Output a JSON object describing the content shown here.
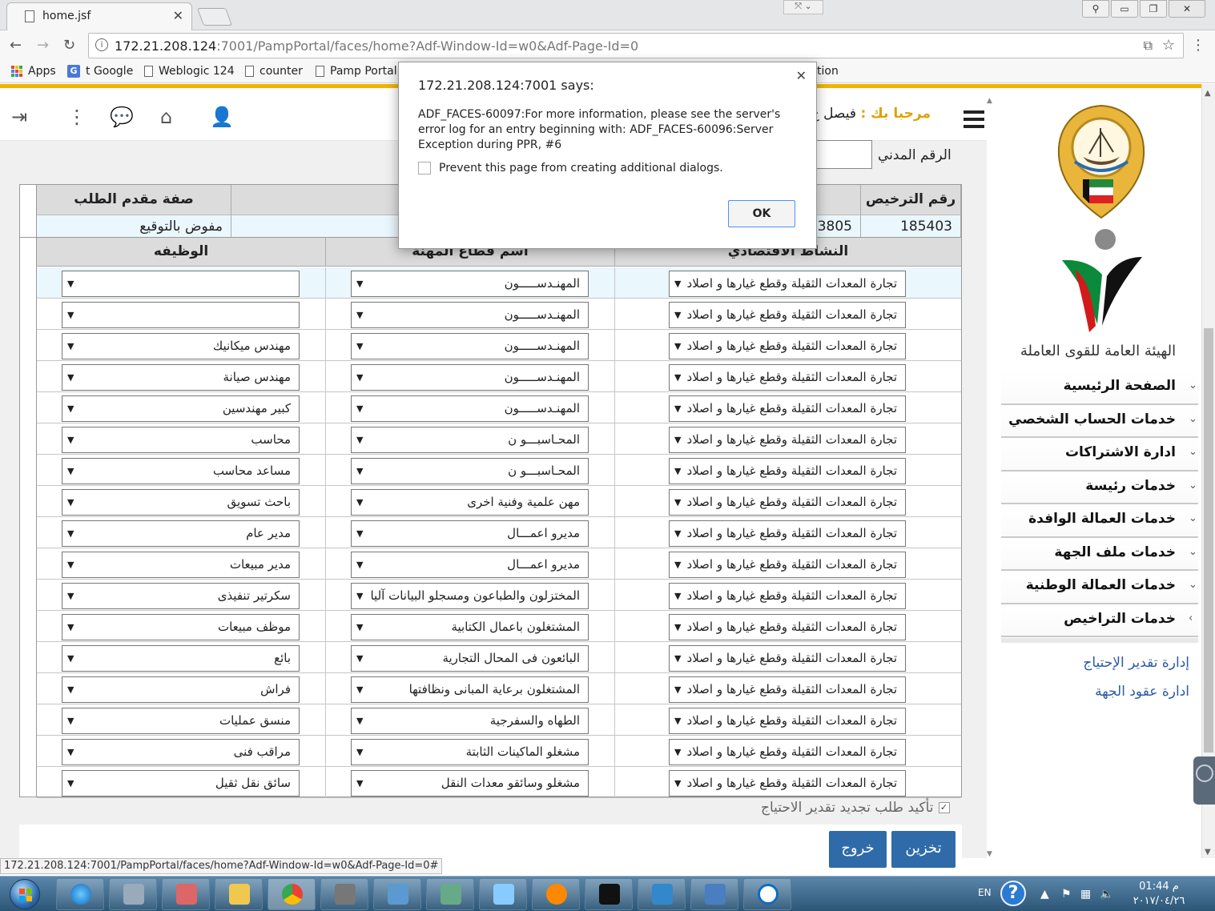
{
  "browser": {
    "tab_title": "home.jsf",
    "url_host": "172.21.208.124",
    "url_rest": ":7001/PampPortal/faces/home?Adf-Window-Id=w0&Adf-Page-Id=0",
    "bookmarks": [
      "Apps",
      "t Google",
      "Weblogic 124",
      "counter",
      "Pamp Portal"
    ],
    "bookmark_partial": "tion",
    "status_url": "172.21.208.124:7001/PampPortal/faces/home?Adf-Window-Id=w0&Adf-Page-Id=0#"
  },
  "header": {
    "welcome_label": "مرحبا بك :",
    "user_name": "فيصل ج"
  },
  "sidebar": {
    "org_name": "الهيئة العامة للقوى العاملة",
    "items": [
      {
        "label": "الصفحة الرئيسية"
      },
      {
        "label": "خدمات الحساب الشخصي"
      },
      {
        "label": "ادارة الاشتراكات"
      },
      {
        "label": "خدمات رئيسة"
      },
      {
        "label": "خدمات العمالة الوافدة"
      },
      {
        "label": "خدمات ملف الجهة"
      },
      {
        "label": "خدمات العمالة الوطنية"
      },
      {
        "label": "خدمات التراخيص"
      }
    ],
    "links": [
      "إدارة تقدير الإحتياج",
      "ادارة عقود الجهة"
    ]
  },
  "form": {
    "civil_id_label": "الرقم المدني",
    "license_table": {
      "headers": [
        "رقم الترخيص",
        "صفة مقدم الطلب"
      ],
      "values": [
        "185403",
        "3805",
        "مفوض بالتوقيع"
      ]
    },
    "grid": {
      "headers": [
        "النشاط الاقتصادي",
        "اسم قطاع المهنة",
        "الوظيفه"
      ],
      "rows": [
        {
          "activity": "تجارة المعدات الثقيلة وقطع غيارها و اصلاد",
          "sector": "المهنـدســـــون",
          "job": ""
        },
        {
          "activity": "تجارة المعدات الثقيلة وقطع غيارها و اصلاد",
          "sector": "المهنـدســـــون",
          "job": ""
        },
        {
          "activity": "تجارة المعدات الثقيلة وقطع غيارها و اصلاد",
          "sector": "المهنـدســـــون",
          "job": "مهندس ميكانيك"
        },
        {
          "activity": "تجارة المعدات الثقيلة وقطع غيارها و اصلاد",
          "sector": "المهنـدســـــون",
          "job": "مهندس صيانة"
        },
        {
          "activity": "تجارة المعدات الثقيلة وقطع غيارها و اصلاد",
          "sector": "المهنـدســـــون",
          "job": "كبير مهندسين"
        },
        {
          "activity": "تجارة المعدات الثقيلة وقطع غيارها و اصلاد",
          "sector": "المحـاسبـــو ن",
          "job": "محاسب"
        },
        {
          "activity": "تجارة المعدات الثقيلة وقطع غيارها و اصلاد",
          "sector": "المحـاسبـــو ن",
          "job": "مساعد محاسب"
        },
        {
          "activity": "تجارة المعدات الثقيلة وقطع غيارها و اصلاد",
          "sector": "مهن علمية وفنية اخرى",
          "job": "باحث تسويق"
        },
        {
          "activity": "تجارة المعدات الثقيلة وقطع غيارها و اصلاد",
          "sector": "مديرو اعمـــال",
          "job": "مدير عام"
        },
        {
          "activity": "تجارة المعدات الثقيلة وقطع غيارها و اصلاد",
          "sector": "مديرو اعمـــال",
          "job": "مدير مبيعات"
        },
        {
          "activity": "تجارة المعدات الثقيلة وقطع غيارها و اصلاد",
          "sector": "المختزلون والطباعون ومسجلو البيانات آليا",
          "job": "سكرتير تنفيذى"
        },
        {
          "activity": "تجارة المعدات الثقيلة وقطع غيارها و اصلاد",
          "sector": "المشتغلون باعمال الكتابية",
          "job": "موظف مبيعات"
        },
        {
          "activity": "تجارة المعدات الثقيلة وقطع غيارها و اصلاد",
          "sector": "البائعون فى المحال التجارية",
          "job": "بائع"
        },
        {
          "activity": "تجارة المعدات الثقيلة وقطع غيارها و اصلاد",
          "sector": "المشتغلون برعاية المبانى ونظافتها",
          "job": "فراش"
        },
        {
          "activity": "تجارة المعدات الثقيلة وقطع غيارها و اصلاد",
          "sector": "الطهاه والسفرجية",
          "job": "منسق عمليات"
        },
        {
          "activity": "تجارة المعدات الثقيلة وقطع غيارها و اصلاد",
          "sector": "مشغلو الماكينات الثابتة",
          "job": "مراقب فنى"
        },
        {
          "activity": "تجارة المعدات الثقيلة وقطع غيارها و اصلاد",
          "sector": "مشغلو وسائقو معدات النقل",
          "job": "سائق نقل ثقيل"
        }
      ]
    },
    "confirm_label": "تأكيد طلب تجديد تقدير الاحتياج",
    "save_button": "تخزين",
    "exit_button": "خروج"
  },
  "dialog": {
    "title": "172.21.208.124:7001 says:",
    "message": "ADF_FACES-60097:For more information, please see the server's error log for an entry beginning with: ADF_FACES-60096:Server Exception during PPR, #6",
    "checkbox_label": "Prevent this page from creating additional dialogs.",
    "ok_label": "OK"
  },
  "taskbar": {
    "lang": "EN",
    "time": "01:44 م",
    "date": "٢٠١٧/٠٤/٢٦"
  }
}
